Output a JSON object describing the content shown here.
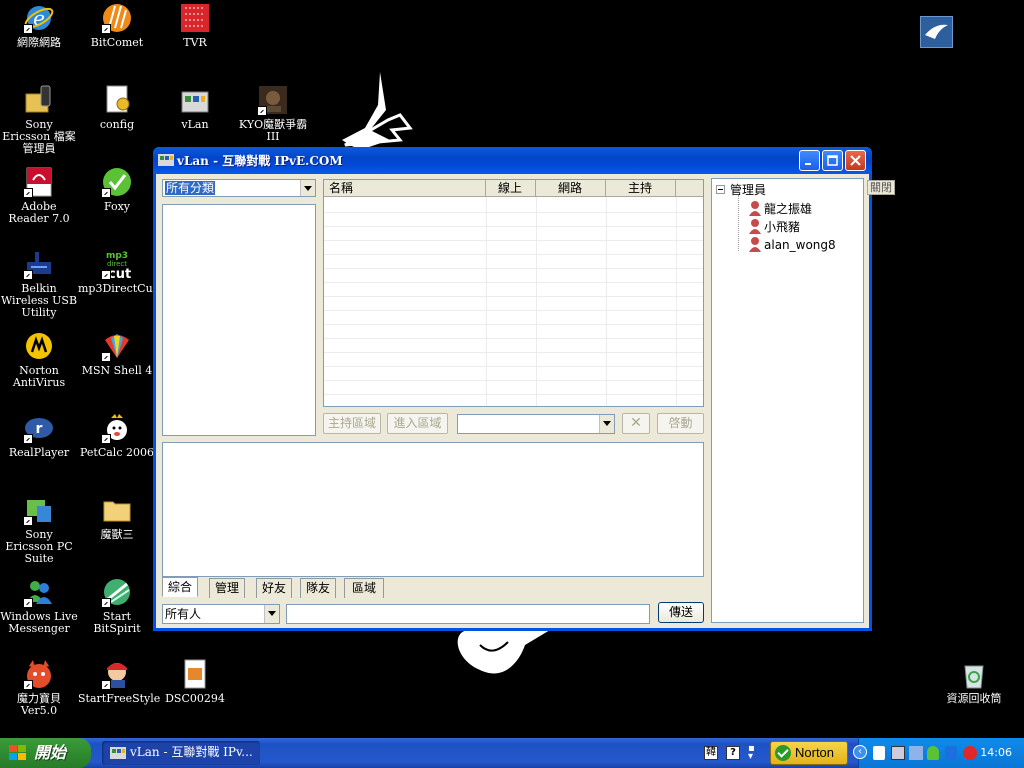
{
  "desktop": {
    "icons": [
      {
        "label": "網際網路"
      },
      {
        "label": "BitComet"
      },
      {
        "label": "TVR"
      },
      {
        "label": "Sony Ericsson 檔案管理員"
      },
      {
        "label": "config"
      },
      {
        "label": "vLan"
      },
      {
        "label": "KYO魔獸爭霸 III"
      },
      {
        "label": "Adobe Reader 7.0"
      },
      {
        "label": "Foxy"
      },
      {
        "label": "Belkin Wireless USB Utility"
      },
      {
        "label": "mp3DirectCut"
      },
      {
        "label": "Norton AntiVirus"
      },
      {
        "label": "MSN Shell 4"
      },
      {
        "label": "RealPlayer"
      },
      {
        "label": "PetCalc 2006"
      },
      {
        "label": "Sony Ericsson PC Suite"
      },
      {
        "label": "魔獸三"
      },
      {
        "label": "Windows Live Messenger"
      },
      {
        "label": "Start BitSpirit"
      },
      {
        "label": "魔力寶貝 Ver5.0"
      },
      {
        "label": "StartFreeStyle"
      },
      {
        "label": "DSC00294"
      },
      {
        "label": "資源回收筒"
      }
    ],
    "mini_icons": {
      "mp3_text": "mp3",
      "direct_text": "direct",
      "cut_text": ":cut"
    }
  },
  "window": {
    "title": "vLan - 互聯對戰 IPvE.COM",
    "category_combo": "所有分類",
    "grid_headers": [
      "名稱",
      "線上",
      "網路",
      "主持"
    ],
    "buttons": {
      "host_area": "主持區域",
      "enter_area": "進入區域",
      "close_x": "✕",
      "launch": "啓動"
    },
    "tabs": [
      "綜合",
      "管理",
      "好友",
      "隊友",
      "區域"
    ],
    "recipient_combo": "所有人",
    "send_button": "傳送",
    "tree": {
      "root": "管理員",
      "members": [
        "龍之振雄",
        "小飛豬",
        "alan_wong8"
      ]
    },
    "close_label": "關閉"
  },
  "taskbar": {
    "start_label": "開始",
    "task_title": "vLan - 互聯對戰 IPv...",
    "norton_label": "Norton",
    "clock": "14:06",
    "lang_label": "韓",
    "help_label": "?"
  },
  "colors": {
    "title_blue": "#0147d4",
    "taskbar_blue": "#2458cc",
    "start_green": "#2f8c2f",
    "selection": "#316ac5"
  }
}
